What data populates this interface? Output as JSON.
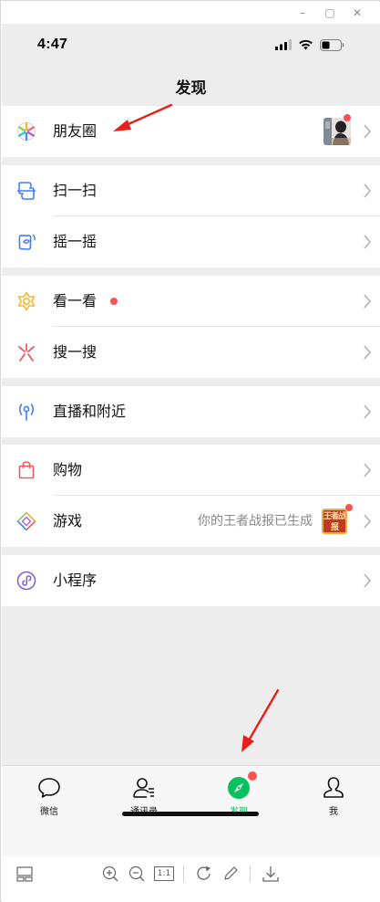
{
  "window": {
    "minimize": "–",
    "maximize": "▢",
    "close": "✕"
  },
  "status": {
    "time": "4:47",
    "icons": [
      "signal-icon",
      "wifi-icon",
      "battery-icon"
    ]
  },
  "nav": {
    "title": "发现"
  },
  "groups": [
    {
      "items": [
        {
          "label": "朋友圈",
          "icon": "moments-icon",
          "badge": "red-dot"
        }
      ]
    },
    {
      "items": [
        {
          "label": "扫一扫",
          "icon": "scan-icon"
        },
        {
          "label": "摇一摇",
          "icon": "shake-icon"
        }
      ]
    },
    {
      "items": [
        {
          "label": "看一看",
          "icon": "top-stories-icon",
          "badge": "red-dot"
        },
        {
          "label": "搜一搜",
          "icon": "search-icon"
        }
      ]
    },
    {
      "items": [
        {
          "label": "直播和附近",
          "icon": "live-nearby-icon"
        }
      ]
    },
    {
      "items": [
        {
          "label": "购物",
          "icon": "shopping-bag-icon"
        },
        {
          "label": "游戏",
          "icon": "game-icon",
          "subtitle": "你的王者战报已生成",
          "thumb_text": "王者战报"
        }
      ]
    },
    {
      "items": [
        {
          "label": "小程序",
          "icon": "mini-program-icon"
        }
      ]
    }
  ],
  "tabs": [
    {
      "label": "微信",
      "icon": "chat-bubble-icon"
    },
    {
      "label": "通讯录",
      "icon": "contacts-icon"
    },
    {
      "label": "发现",
      "icon": "compass-icon",
      "active": true
    },
    {
      "label": "我",
      "icon": "person-icon"
    }
  ],
  "colors": {
    "accent": "#07c160",
    "badge": "#fa5151",
    "background": "#ededed"
  },
  "toolbar": {
    "buttons": [
      "layout-toggle-icon",
      "zoom-in-icon",
      "zoom-out-icon",
      "actual-size-icon",
      "rotate-icon",
      "edit-pencil-icon",
      "download-icon"
    ],
    "actual_size_label": "1:1"
  }
}
